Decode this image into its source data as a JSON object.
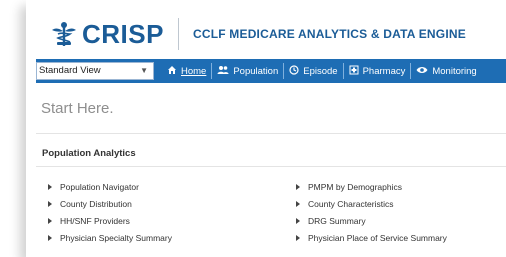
{
  "brand": {
    "logo_text": "CRISP",
    "logo_color": "#1b5c97",
    "app_title": "CCLF MEDICARE ANALYTICS & DATA ENGINE"
  },
  "navbar": {
    "background": "#1e6db4",
    "view_select": {
      "value": "Standard View"
    },
    "items": [
      {
        "label": "Home",
        "icon": "home-icon"
      },
      {
        "label": "Population",
        "icon": "people-icon"
      },
      {
        "label": "Episode",
        "icon": "clock-icon"
      },
      {
        "label": "Pharmacy",
        "icon": "pharmacy-icon"
      },
      {
        "label": "Monitoring",
        "icon": "eye-icon"
      }
    ]
  },
  "main": {
    "heading": "Start Here.",
    "section_title": "Population Analytics",
    "left_links": [
      "Population Navigator",
      "County Distribution",
      "HH/SNF Providers",
      "Physician Specialty Summary"
    ],
    "right_links": [
      "PMPM by Demographics",
      "County Characteristics",
      "DRG Summary",
      "Physician Place of Service Summary"
    ]
  }
}
